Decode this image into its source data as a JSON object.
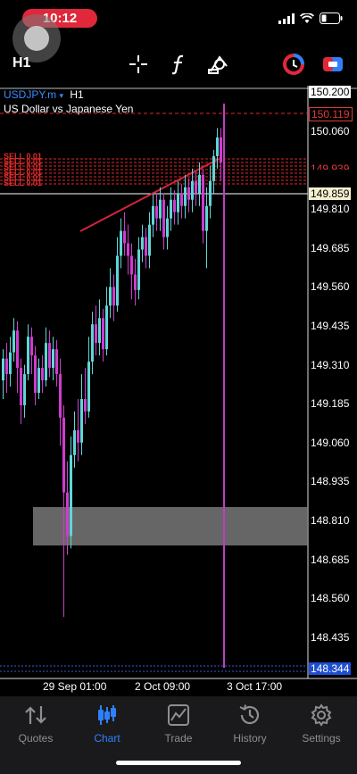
{
  "status": {
    "time": "10:12"
  },
  "toolbar": {
    "timeframe": "H1"
  },
  "chart": {
    "symbol": "USDJPY.m",
    "symbol_marker": "▾",
    "timeframe": "H1",
    "description": "US Dollar vs Japanese Yen",
    "price_ticks": [
      "150.060",
      "149.810",
      "149.685",
      "149.560",
      "149.435",
      "149.310",
      "149.185",
      "149.060",
      "148.935",
      "148.810",
      "148.685",
      "148.560",
      "148.435"
    ],
    "boxed_prices": {
      "top": "150.200",
      "red": "150.119",
      "partial": "149.939",
      "current": "149.859",
      "bottom": "148.344"
    },
    "time_labels": [
      "29 Sep 01:00",
      "2 Oct 09:00",
      "3 Oct 17:00"
    ],
    "order_label": "SELL 0.01",
    "colors": {
      "bull": "#5fd6d6",
      "bear": "#d03bd0",
      "trend": "#d4243a",
      "vline": "#c23bc2",
      "sell": "#e02a2a",
      "current": "#ffffff"
    }
  },
  "tabs": [
    {
      "label": "Quotes",
      "icon": "quotes-icon"
    },
    {
      "label": "Chart",
      "icon": "chart-icon"
    },
    {
      "label": "Trade",
      "icon": "trade-icon"
    },
    {
      "label": "History",
      "icon": "history-icon"
    },
    {
      "label": "Settings",
      "icon": "settings-icon"
    }
  ]
}
